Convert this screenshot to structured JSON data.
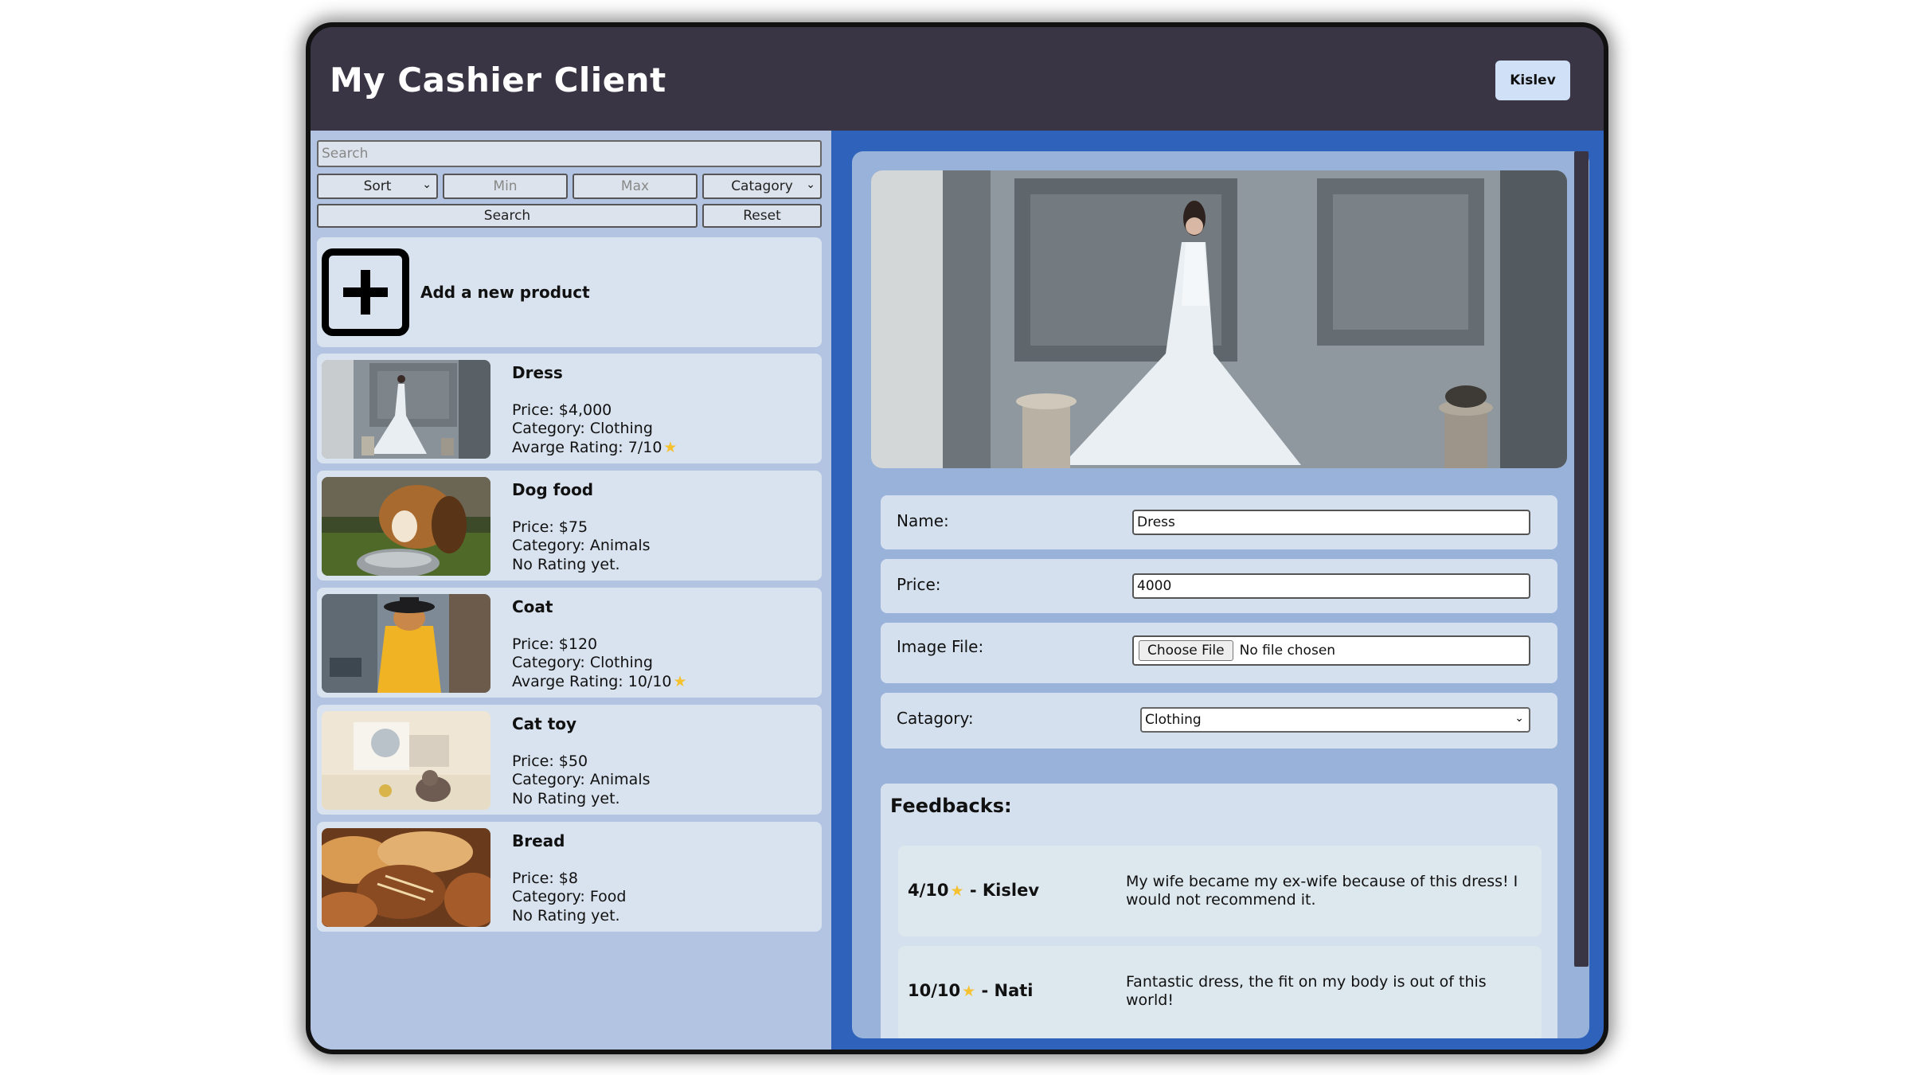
{
  "header": {
    "title": "My Cashier Client",
    "user_button": "Kislev"
  },
  "filters": {
    "search_placeholder": "Search",
    "sort_label": "Sort",
    "min_placeholder": "Min",
    "max_placeholder": "Max",
    "category_label": "Catagory",
    "search_button": "Search",
    "reset_button": "Reset"
  },
  "add_product": {
    "label": "Add a new product"
  },
  "products": [
    {
      "name": "Dress",
      "price": "Price: $4,000",
      "category": "Category: Clothing",
      "rating": "Avarge Rating: 7/10",
      "has_star": true
    },
    {
      "name": "Dog food",
      "price": "Price: $75",
      "category": "Category: Animals",
      "rating": "No Rating yet.",
      "has_star": false
    },
    {
      "name": "Coat",
      "price": "Price: $120",
      "category": "Category: Clothing",
      "rating": "Avarge Rating: 10/10",
      "has_star": true
    },
    {
      "name": "Cat toy",
      "price": "Price: $50",
      "category": "Category: Animals",
      "rating": "No Rating yet.",
      "has_star": false
    },
    {
      "name": "Bread",
      "price": "Price: $8",
      "category": "Category: Food",
      "rating": "No Rating yet.",
      "has_star": false
    }
  ],
  "details": {
    "name_label": "Name:",
    "name_value": "Dress",
    "price_label": "Price:",
    "price_value": "4000",
    "image_label": "Image File:",
    "choose_file": "Choose File",
    "file_status": "No file chosen",
    "category_label": "Catagory:",
    "category_value": "Clothing"
  },
  "feedbacks": {
    "title": "Feedbacks:",
    "items": [
      {
        "score": "4/10",
        "author": "- Kislev",
        "text": "My wife became my ex-wife because of this dress! I would not recommend it."
      },
      {
        "score": "10/10",
        "author": "- Nati",
        "text": "Fantastic dress, the fit on my body is out of this world!"
      }
    ]
  },
  "colors": {
    "header_bg": "#3a3545",
    "left_bg": "#b2c4e2",
    "right_bg": "#2f62bb",
    "card_bg": "#d9e3ef",
    "star": "#f5c12e"
  }
}
